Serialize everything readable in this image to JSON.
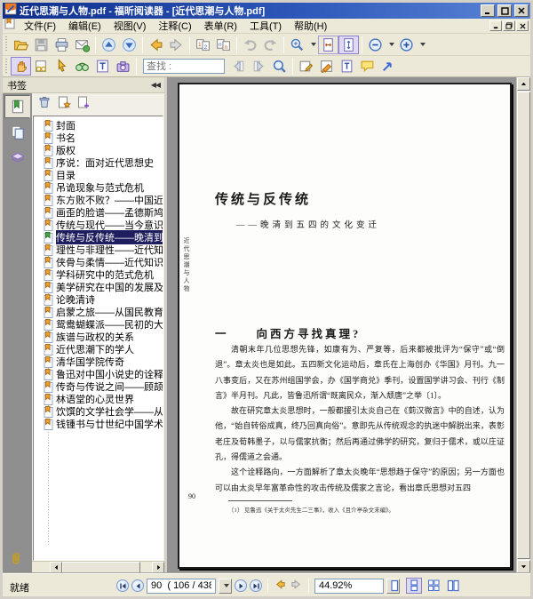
{
  "window": {
    "title": "近代思潮与人物.pdf - 福昕阅读器 - [近代思潮与人物.pdf]"
  },
  "menu": {
    "items": [
      "文件(F)",
      "编辑(E)",
      "视图(V)",
      "注释(C)",
      "表单(R)",
      "工具(T)",
      "帮助(H)"
    ]
  },
  "toolbar": {
    "find_placeholder": "查找 :"
  },
  "sidebar": {
    "title": "书签",
    "collapse_glyph": "◀◀",
    "bookmarks": [
      {
        "label": "封面",
        "selected": false
      },
      {
        "label": "书名",
        "selected": false
      },
      {
        "label": "版权",
        "selected": false
      },
      {
        "label": "序说：面对近代思想史",
        "selected": false
      },
      {
        "label": "目录",
        "selected": false
      },
      {
        "label": "吊诡现象与范式危机",
        "selected": false
      },
      {
        "label": "东方败不败？——中国近代思",
        "selected": false
      },
      {
        "label": "画歪的脸谱——孟德斯鸠的中",
        "selected": false
      },
      {
        "label": "传统与现代——当今意识纠结",
        "selected": false
      },
      {
        "label": "传统与反传统——晚清到五四",
        "selected": true
      },
      {
        "label": "理性与非理性——近代知识分",
        "selected": false
      },
      {
        "label": "侠骨与柔情——近代知识分子",
        "selected": false
      },
      {
        "label": "学科研究中的范式危机",
        "selected": false
      },
      {
        "label": "美学研究在中国的发展及其问",
        "selected": false
      },
      {
        "label": "论晚清诗",
        "selected": false
      },
      {
        "label": "启蒙之旅——从国民教育到国",
        "selected": false
      },
      {
        "label": "鸳鸯蝴蝶派——民初的大众文",
        "selected": false
      },
      {
        "label": "族谱与政权的关系",
        "selected": false
      },
      {
        "label": "近代思潮下的学人",
        "selected": false
      },
      {
        "label": "清华国学院传奇",
        "selected": false
      },
      {
        "label": "鲁迅对中国小说史的诠释个案",
        "selected": false
      },
      {
        "label": "传奇与传说之间——顾颉刚的",
        "selected": false
      },
      {
        "label": "林语堂的心灵世界",
        "selected": false
      },
      {
        "label": "饮馔的文学社会学——从《随",
        "selected": false
      },
      {
        "label": "钱锺书与廿世纪中国学术",
        "selected": false
      }
    ]
  },
  "document": {
    "running_title_vertical": "近代思潮与人物",
    "title": "传统与反传统",
    "subtitle": "——晚清到五四的文化变迁",
    "section_heading": "一　　向西方寻找真理?",
    "paragraphs": [
      "清朝末年几位思想先锋，如康有为、严复等，后来都被批评为“保守”或“倒退”。章太炎也是如此。五四新文化运动后，章氏在上海创办《华国》月刊。九一八事变后，又在苏州组国学会，办《国学商兑》季刊，设置国学讲习会、刊行《制言》半月刊。凡此，皆鲁迅所谓“既离民众，渐入颓唐”之举〔1〕。",
      "故在研究章太炎思想时，一般都援引太炎自己在《菿汉微言》中的自述，认为他，“始自转俗成真，终乃回真向俗”。意即先从传统观念的执迷中解脱出来，表彰老庄及荀韩墨子，以与儒家抗衡；然后再通过佛学的研究，复归于儒术，或以庄证孔，得儒道之会通。",
      "这个诠释路向，一方面解析了章太炎晚年“思想趋于保守”的原因；另一方面也可以由太炎早年富革命性的攻击传统及儒家之言论，看出章氏思想对五四"
    ],
    "page_number": "90",
    "footnote": "〔1〕 见鲁迅《关于太炎先生二三事》，收入《且介亭杂文末编》。"
  },
  "statusbar": {
    "ready": "就绪",
    "page_field": "90  ( 106 / 438",
    "zoom_field": "44.92%"
  },
  "colors": {
    "titlebar_blue": "#2c56b8",
    "toolbar_bg": "#ece9d8",
    "selection_navy": "#1e1e5e",
    "bookmark_flag_orange": "#f0a030",
    "bookmark_flag_green": "#4aa348",
    "doc_background_gray": "#929292"
  }
}
